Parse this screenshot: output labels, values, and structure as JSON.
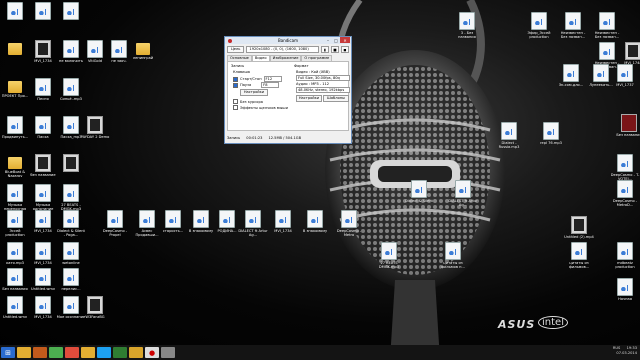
{
  "bandicam": {
    "title": "Bandicam",
    "target_button": "Цель",
    "resolution_field": "1920x1080 - (0, 0), (1600, 1080)",
    "tabs": [
      "Основные",
      "Видео",
      "Изображение",
      "О программе"
    ],
    "active_tab": "Видео",
    "record_section": "Запись",
    "hotkey_label": "Клавиша",
    "start_stop_label": "Старт/Стоп",
    "start_stop_key": "F12",
    "pause_label": "Пауза",
    "pause_key": "F8",
    "settings_button": "Настройки",
    "cursor_option": "Без курсора",
    "effects_option": "Эффекты щелчков мыши",
    "format_section": "Формат",
    "video_format": "Видео : Кой (XBB)",
    "video_detail": "Full Size, 30.00fps, 80q",
    "audio_format": "Аудио : MP3 - 112",
    "audio_detail": "48.0KHz, stereo, 192kbps",
    "format_settings_button": "Настройки",
    "templates_button": "Шаблоны",
    "status_label": "Запись",
    "status_time": "00:01:23",
    "status_size": "12.5MB / 504.1GB"
  },
  "desktop": {
    "icons": [
      {
        "label": "",
        "type": "doc"
      },
      {
        "label": "",
        "type": "doc"
      },
      {
        "label": "",
        "type": "doc"
      },
      {
        "label": "",
        "type": "folder"
      },
      {
        "label": "MVI_1734",
        "type": "vid"
      },
      {
        "label": "не включить",
        "type": "doc"
      },
      {
        "label": "VitiGold",
        "type": "doc"
      },
      {
        "label": "не заоч.",
        "type": "doc"
      },
      {
        "label": "ленинграй",
        "type": "folder"
      },
      {
        "label": "ПРОЕКТ Про...",
        "type": "folder"
      },
      {
        "label": "Песня",
        "type": "doc"
      },
      {
        "label": "Синьё..mp3",
        "type": "doc"
      },
      {
        "label": "Продвинуть...",
        "type": "doc"
      },
      {
        "label": "Пасха",
        "type": "doc"
      },
      {
        "label": "Пасха_mp3",
        "type": "doc"
      },
      {
        "label": "PAYDAY 2 Demo",
        "type": "vid"
      },
      {
        "label": "BlueBoat & Nazarov",
        "type": "folder"
      },
      {
        "label": "без название",
        "type": "vid"
      },
      {
        "label": "",
        "type": "vid"
      },
      {
        "label": "Музыка переносная",
        "type": "doc"
      },
      {
        "label": "Музыка однотипие",
        "type": "doc"
      },
      {
        "label": "27 BEATS - DMGK.mp3",
        "type": "doc"
      },
      {
        "label": "Эссей production",
        "type": "doc"
      },
      {
        "label": "MVI_1734",
        "type": "doc"
      },
      {
        "label": "Dialect & Silent - Poga...",
        "type": "doc"
      },
      {
        "label": "DeepCosmo - Propel",
        "type": "doc"
      },
      {
        "label": "Асвес Продавши...",
        "type": "doc"
      },
      {
        "label": "старость...",
        "type": "doc"
      },
      {
        "label": "В знакомому",
        "type": "doc"
      },
      {
        "label": "РОДИНА...",
        "type": "doc"
      },
      {
        "label": "DIALECT ft Artur Ag...",
        "type": "doc"
      },
      {
        "label": "MVI_1734",
        "type": "doc"
      },
      {
        "label": "В знакомому",
        "type": "doc"
      },
      {
        "label": "DeepCosmo - Metro",
        "type": "doc"
      },
      {
        "label": "катя.mp3",
        "type": "doc"
      },
      {
        "label": "MVI_1734",
        "type": "doc"
      },
      {
        "label": "wetonline",
        "type": "doc"
      },
      {
        "label": "Без названия",
        "type": "doc"
      },
      {
        "label": "Untitled.wmv",
        "type": "doc"
      },
      {
        "label": "перелис...",
        "type": "doc"
      },
      {
        "label": "Untitled.wmv",
        "type": "doc"
      },
      {
        "label": "MVI_1734",
        "type": "doc"
      },
      {
        "label": "Мое осознание",
        "type": "doc"
      },
      {
        "label": "W3FanzBG",
        "type": "vid"
      },
      {
        "label": "27 BEATS DMGK.mp3",
        "type": "doc"
      },
      {
        "label": "цитаты из фильмов п...",
        "type": "doc"
      },
      {
        "label": "Dialect & Silent",
        "type": "doc"
      },
      {
        "label": "DIALECT ft Artur Ag...",
        "type": "doc"
      },
      {
        "label": "Dialect - Russia.mp3",
        "type": "doc"
      },
      {
        "label": "repl 76.mp3",
        "type": "doc"
      },
      {
        "label": "3 - Без названия",
        "type": "doc"
      },
      {
        "label": "Эфир_Эссей production",
        "type": "doc"
      },
      {
        "label": "Неизвестен - Без назван...",
        "type": "doc"
      },
      {
        "label": "Неизвестен - Без назван...",
        "type": "doc"
      },
      {
        "label": "Неизвестен - Без назван...",
        "type": "doc"
      },
      {
        "label": "MVI_1748",
        "type": "vid"
      },
      {
        "label": "Эк.сом.дло...",
        "type": "doc"
      },
      {
        "label": "Лупеекать...",
        "type": "doc"
      },
      {
        "label": "MVI_1737",
        "type": "doc"
      },
      {
        "label": "Без названия",
        "type": "redimg"
      },
      {
        "label": "DeepCosmo - T-VOTEl...",
        "type": "doc"
      },
      {
        "label": "DeepCosmo - MetroD...",
        "type": "doc"
      },
      {
        "label": "Untitled (2).mp4",
        "type": "vid"
      },
      {
        "label": "цитаты из фильмов...",
        "type": "doc"
      },
      {
        "label": "mdbeatz production",
        "type": "doc"
      },
      {
        "label": "Ночная",
        "type": "doc"
      }
    ]
  },
  "taskbar": {
    "items": [
      "start-icon",
      "explorer-icon",
      "media-icon",
      "torrent-icon",
      "chrome-icon",
      "folder-icon",
      "skype-icon",
      "store-icon",
      "chrome2-icon",
      "record-icon",
      "app-icon"
    ],
    "time": "19:33",
    "date": "07.03.2014",
    "lang": "RUS"
  },
  "wallpaper": {
    "brand": "ASUS",
    "partner": "intel"
  }
}
